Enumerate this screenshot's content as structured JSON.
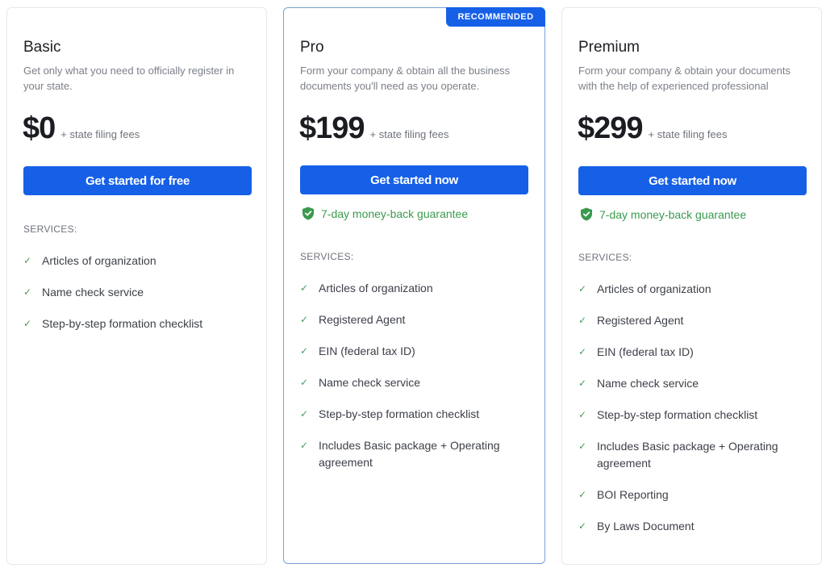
{
  "plans": [
    {
      "name": "Basic",
      "description": "Get only what you need to officially register in your state.",
      "price": "$0",
      "fees": "+ state filing fees",
      "cta": "Get started for free",
      "services_label": "SERVICES:",
      "services": [
        "Articles of organization",
        "Name check service",
        "Step-by-step formation checklist"
      ]
    },
    {
      "badge": "RECOMMENDED",
      "name": "Pro",
      "description": "Form your company & obtain all the business documents you'll need as you operate.",
      "price": "$199",
      "fees": "+ state filing fees",
      "cta": "Get started now",
      "guarantee": "7-day money-back guarantee",
      "services_label": "SERVICES:",
      "services": [
        "Articles of organization",
        "Registered Agent",
        "EIN (federal tax ID)",
        "Name check service",
        "Step-by-step formation checklist",
        "Includes Basic package + Operating agreement"
      ]
    },
    {
      "name": "Premium",
      "description": "Form your company & obtain your documents with the help of experienced professional",
      "price": "$299",
      "fees": "+ state filing fees",
      "cta": "Get started now",
      "guarantee": "7-day money-back guarantee",
      "services_label": "SERVICES:",
      "services": [
        "Articles of organization",
        "Registered Agent",
        "EIN (federal tax ID)",
        "Name check service",
        "Step-by-step formation checklist",
        "Includes Basic package + Operating agreement",
        "BOI Reporting",
        "By Laws Document"
      ]
    }
  ],
  "colors": {
    "accent": "#1660e8",
    "guarantee": "#3a9a4e",
    "check": "#4a9a5a"
  }
}
